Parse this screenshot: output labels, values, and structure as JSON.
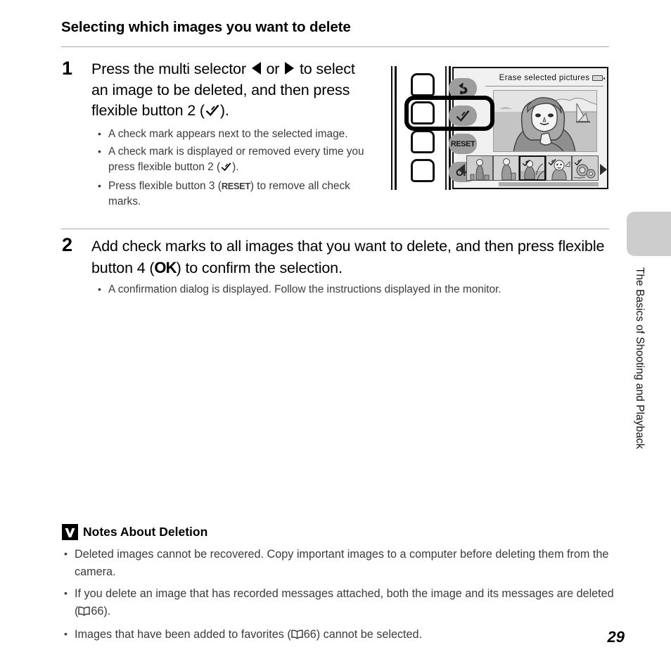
{
  "page": {
    "number": "29",
    "side_tab_label": "The Basics of Shooting and Playback"
  },
  "section": {
    "heading": "Selecting which images you want to delete"
  },
  "steps": [
    {
      "number": "1",
      "text_part_1": "Press the multi selector ",
      "text_part_2": " or ",
      "text_part_3": " to select an image to be deleted, and then press flexible button 2 (",
      "text_part_4": ").",
      "bullets": [
        {
          "text_1": "A check mark appears next to the selected image.",
          "text_2": "",
          "text_3": ""
        },
        {
          "text_1": "A check mark is displayed or removed every time you press flexible button 2 (",
          "text_2": "",
          "text_3": ")."
        },
        {
          "text_1": "Press flexible button 3 (",
          "text_2": "RESET",
          "text_3": ") to remove all check marks."
        }
      ]
    },
    {
      "number": "2",
      "text_part_1": "Add check marks to all images that you want to delete, and then press flexible button 4 (",
      "text_part_2": "OK",
      "text_part_3": ") to confirm the selection.",
      "bullets": [
        {
          "text_1": "A confirmation dialog is displayed. Follow the instructions displayed in the monitor."
        }
      ]
    }
  ],
  "camera": {
    "lcd_title": "Erase selected pictures",
    "soft_keys": [
      {
        "name": "back",
        "label": ""
      },
      {
        "name": "check",
        "label": ""
      },
      {
        "name": "reset",
        "label": "RESET"
      },
      {
        "name": "ok",
        "label": "OK"
      }
    ],
    "thumbnails": [
      {
        "index": "1",
        "checked": false,
        "selected": false
      },
      {
        "index": "2",
        "checked": false,
        "selected": false
      },
      {
        "index": "3",
        "checked": true,
        "selected": true
      },
      {
        "index": "4",
        "checked": true,
        "selected": false
      },
      {
        "index": "5",
        "checked": true,
        "selected": false
      }
    ],
    "physical_buttons": [
      {
        "index": "1",
        "highlighted": false
      },
      {
        "index": "2",
        "highlighted": true
      },
      {
        "index": "3",
        "highlighted": false
      },
      {
        "index": "4",
        "highlighted": false
      }
    ]
  },
  "notes": {
    "heading": "Notes About Deletion",
    "items": [
      {
        "text_1": "Deleted images cannot be recovered. Copy important images to a computer before deleting them from the camera.",
        "page_ref": "",
        "text_2": ""
      },
      {
        "text_1": "If you delete an image that has recorded messages attached, both the image and its messages are deleted (",
        "page_ref": "66",
        "text_2": ")."
      },
      {
        "text_1": "Images that have been added to favorites (",
        "page_ref": "66",
        "text_2": ") cannot be selected."
      }
    ]
  },
  "colors": {
    "rule": "#a9a9a9",
    "body_text": "#3b3b3b",
    "tab_gray": "#cdcdcd",
    "soft_key_gray": "#9d9d9d",
    "lcd_bg": "#f0f0f0"
  }
}
